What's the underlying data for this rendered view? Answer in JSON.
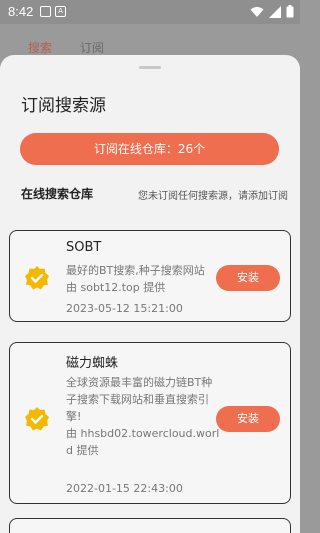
{
  "status_bar": {
    "time": "8:42",
    "left_icons": [
      "image-icon",
      "text-icon"
    ],
    "right_icons": [
      "wifi-icon",
      "signal-icon",
      "battery-icon"
    ]
  },
  "background_tabs": [
    {
      "label": "搜索",
      "active": true
    },
    {
      "label": "订阅",
      "active": false
    }
  ],
  "sheet": {
    "title": "订阅搜索源",
    "repo_button_label": "订阅在线仓库：26个",
    "section_title": "在线搜索仓库",
    "section_hint": "您未订阅任何搜索源，请添加订阅",
    "items": [
      {
        "name": "SOBT",
        "description": "最好的BT搜索,种子搜索网站",
        "provider": "由 sobt12.top 提供",
        "date": "2023-05-12 15:21:00",
        "action_label": "安装",
        "icon": "verified-badge-icon"
      },
      {
        "name": "磁力蜘蛛",
        "description": "全球资源最丰富的磁力链BT种子搜索下载网站和垂直搜索引擎!",
        "provider": "由 hhsbd02.towercloud.world 提供",
        "date": "2022-01-15 22:43:00",
        "action_label": "安装",
        "icon": "verified-badge-icon"
      }
    ]
  },
  "colors": {
    "accent": "#ee6e4f",
    "badge_yellow": "#f5b800",
    "sheet_bg": "#f2f2f2",
    "scrim": "#9a9a9a"
  }
}
